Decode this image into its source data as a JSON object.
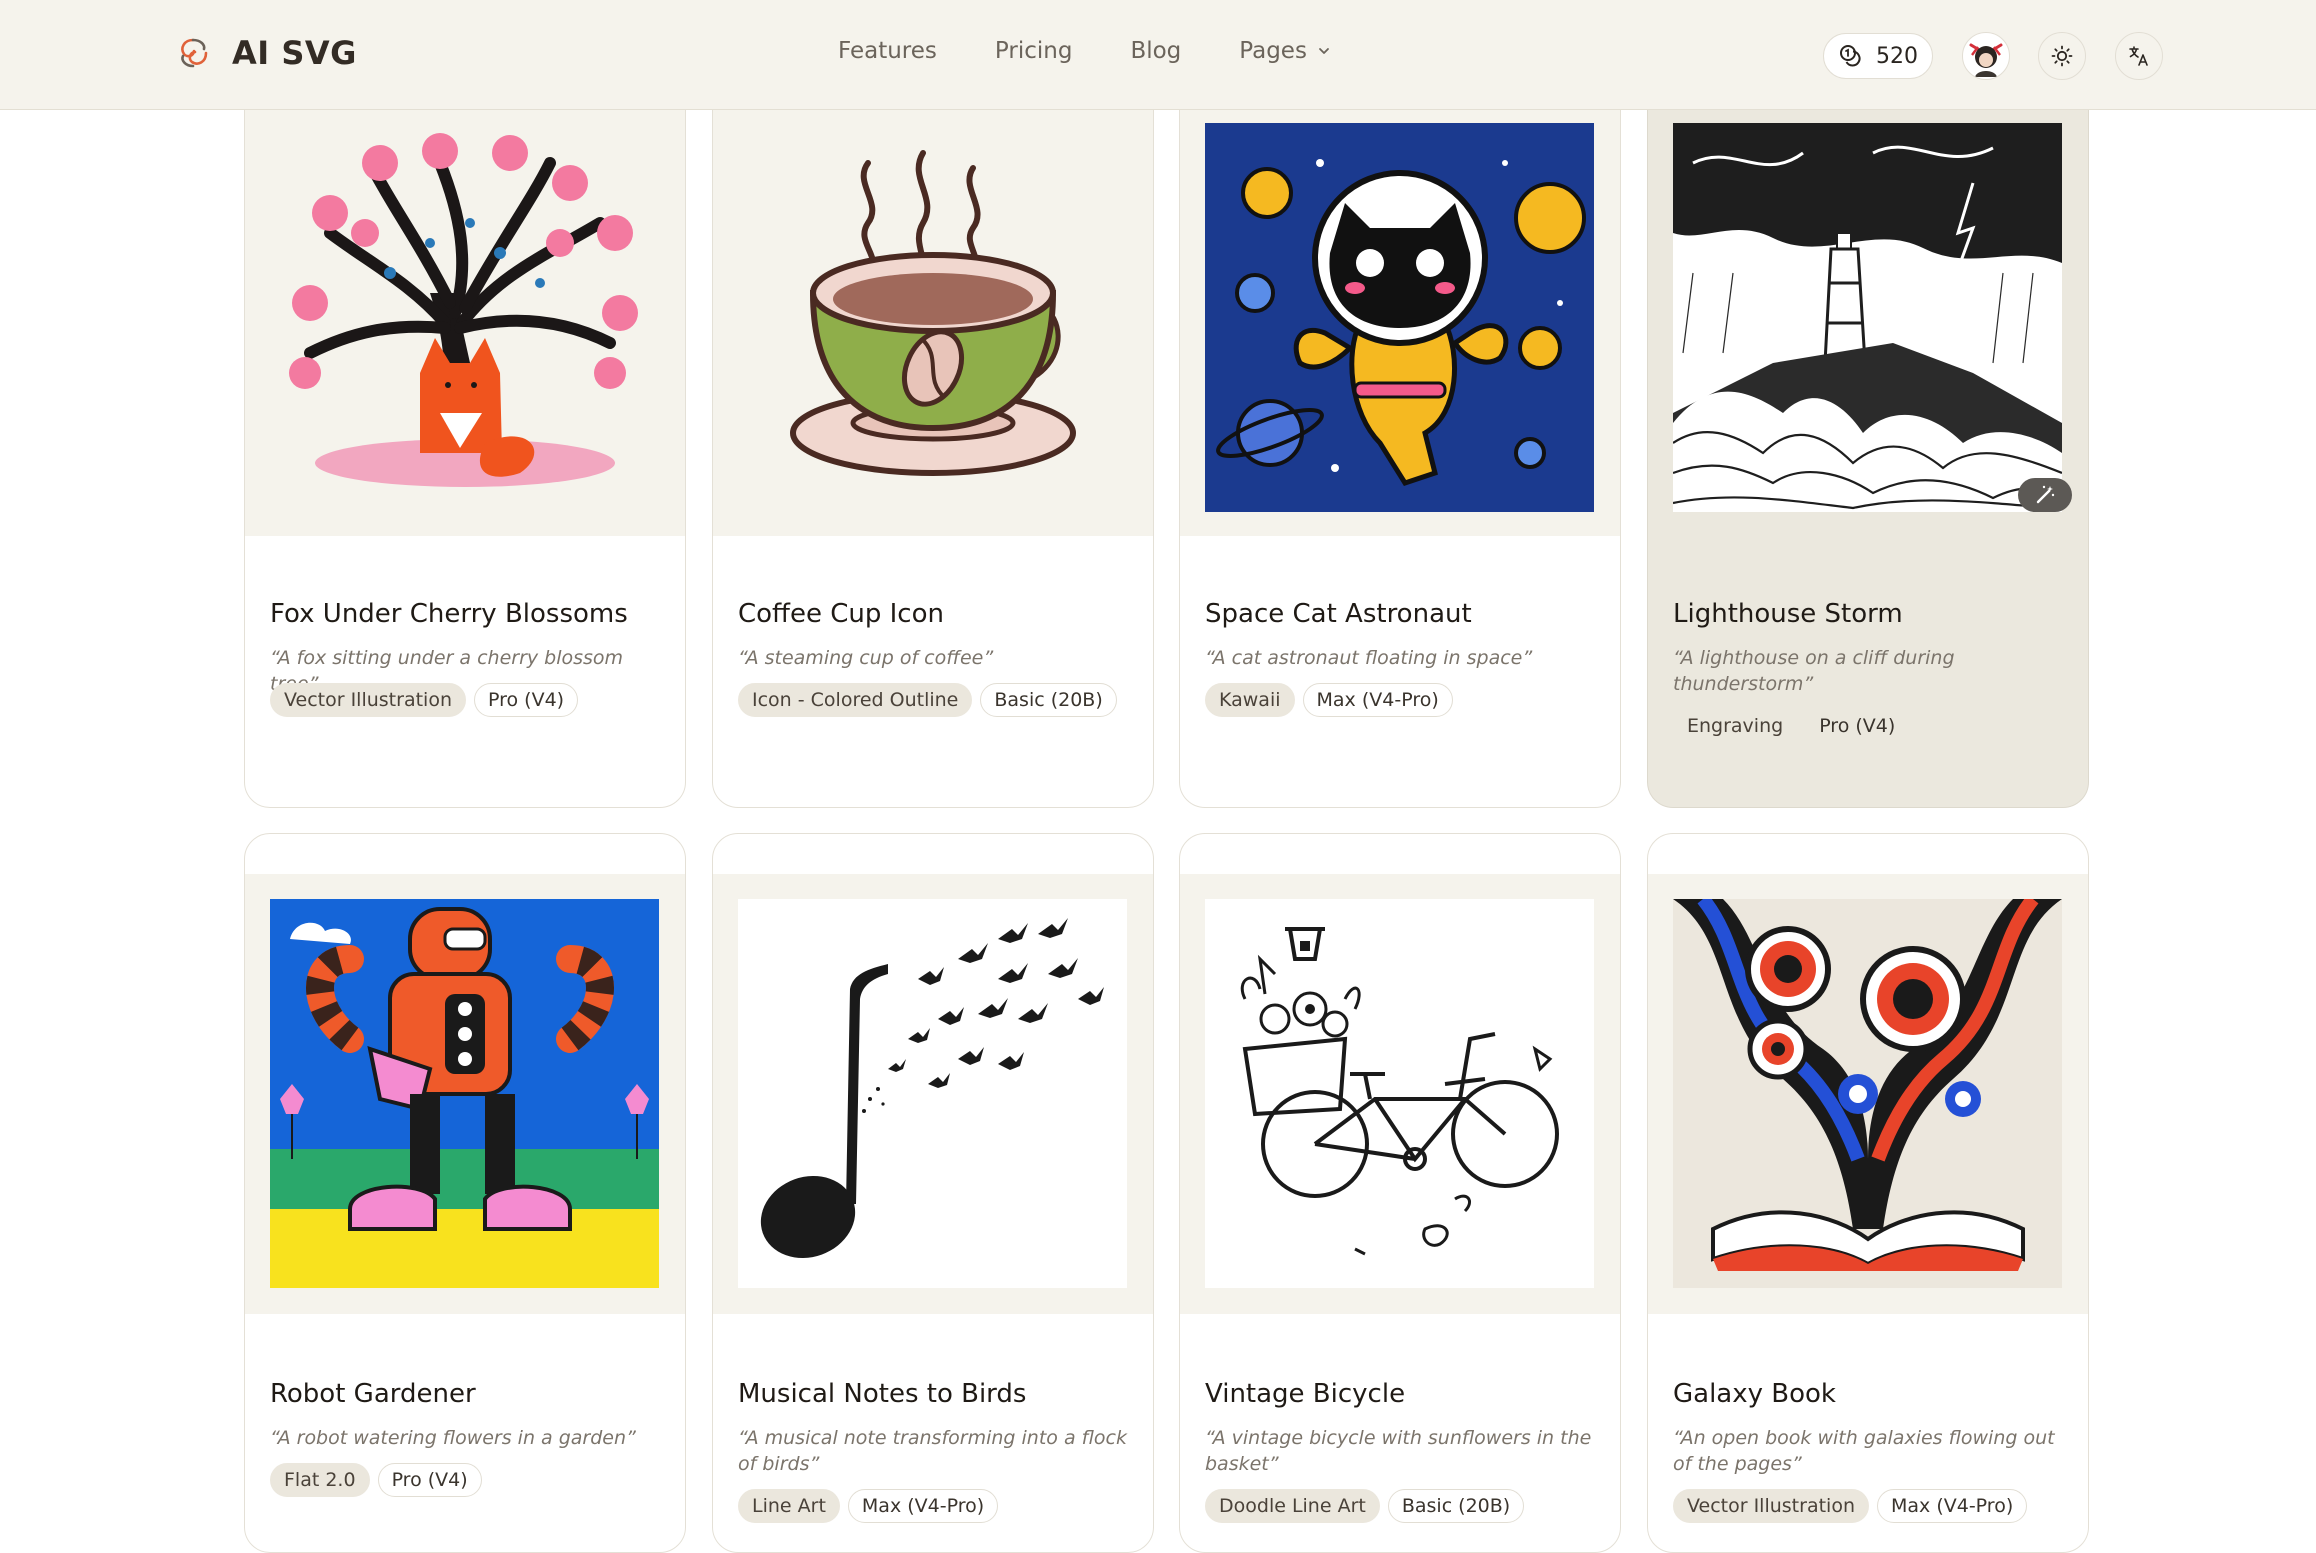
{
  "header": {
    "brand": "AI SVG",
    "nav": [
      {
        "label": "Features"
      },
      {
        "label": "Pricing"
      },
      {
        "label": "Blog"
      },
      {
        "label": "Pages"
      }
    ],
    "credits": "520",
    "icons": {
      "logo": "swirl-logo-icon",
      "credits": "coins-icon",
      "theme": "sun-icon",
      "language": "translate-icon"
    }
  },
  "colors": {
    "header_bg": "#f5f3ec",
    "card_thumb_bg": "#f5f3ec",
    "highlight_card_bg": "#ebe8de",
    "style_tag_bg": "#ebe7dd"
  },
  "cards": [
    {
      "title": "Fox Under Cherry Blossoms",
      "prompt": "“A fox sitting under a cherry blossom tree”",
      "style": "Vector Illustration",
      "model": "Pro (V4)"
    },
    {
      "title": "Coffee Cup Icon",
      "prompt": "“A steaming cup of coffee”",
      "style": "Icon - Colored Outline",
      "model": "Basic (20B)"
    },
    {
      "title": "Space Cat Astronaut",
      "prompt": "“A cat astronaut floating in space”",
      "style": "Kawaii",
      "model": "Max (V4-Pro)"
    },
    {
      "title": "Lighthouse Storm",
      "prompt": "“A lighthouse on a cliff during thunderstorm”",
      "style": "Engraving",
      "model": "Pro (V4)"
    },
    {
      "title": "Robot Gardener",
      "prompt": "“A robot watering flowers in a garden”",
      "style": "Flat 2.0",
      "model": "Pro (V4)"
    },
    {
      "title": "Musical Notes to Birds",
      "prompt": "“A musical note transforming into a flock of birds”",
      "style": "Line Art",
      "model": "Max (V4-Pro)"
    },
    {
      "title": "Vintage Bicycle",
      "prompt": "“A vintage bicycle with sunflowers in the basket”",
      "style": "Doodle Line Art",
      "model": "Basic (20B)"
    },
    {
      "title": "Galaxy Book",
      "prompt": "“An open book with galaxies flowing out of the pages”",
      "style": "Vector Illustration",
      "model": "Max (V4-Pro)"
    }
  ]
}
